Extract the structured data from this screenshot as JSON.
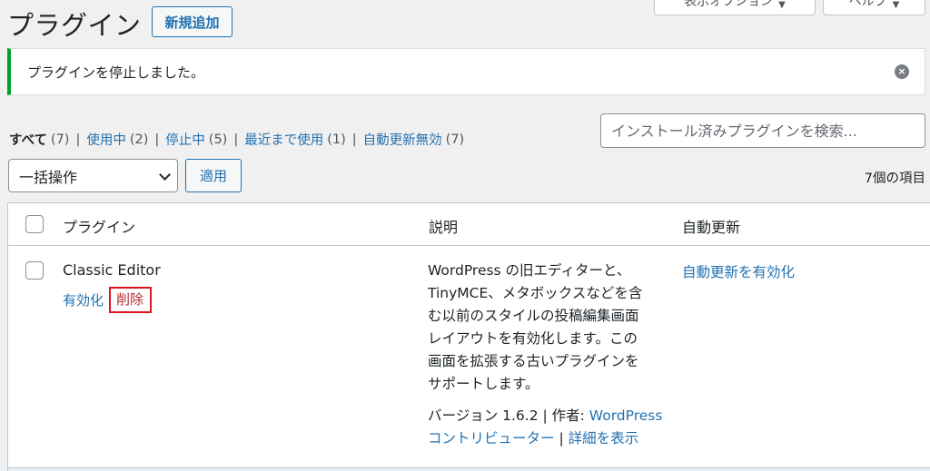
{
  "header": {
    "title": "プラグイン",
    "add_new_label": "新規追加",
    "screen_options_label": "表示オプション",
    "help_label": "ヘルプ"
  },
  "notice": {
    "message": "プラグインを停止しました。",
    "dismiss_icon": "×"
  },
  "filters": [
    {
      "label": "すべて",
      "count": "(7)",
      "current": true
    },
    {
      "label": "使用中",
      "count": "(2)"
    },
    {
      "label": "停止中",
      "count": "(5)"
    },
    {
      "label": "最近まで使用",
      "count": "(1)"
    },
    {
      "label": "自動更新無効",
      "count": "(7)"
    }
  ],
  "search": {
    "placeholder": "インストール済みプラグインを検索..."
  },
  "bulk_actions": {
    "selected": "一括操作",
    "apply_label": "適用",
    "item_count": "7個の項目"
  },
  "table": {
    "columns": {
      "plugin": "プラグイン",
      "description": "説明",
      "auto_update": "自動更新"
    },
    "rows": [
      {
        "name": "Classic Editor",
        "actions": {
          "activate": "有効化",
          "delete": "削除"
        },
        "description_lines": [
          "WordPress の旧エディターと、",
          "TinyMCE、メタボックスなどを含",
          "む以前のスタイルの投稿編集画面",
          "レイアウトを有効化します。この",
          "画面を拡張する古いプラグインを",
          "サポートします。"
        ],
        "version_text": "バージョン 1.6.2 | 作者:",
        "author_link": "WordPress",
        "author_link_line2": "コントリビューター",
        "meta_sep": "|",
        "details_link": "詳細を表示",
        "auto_update_link": "自動更新を有効化"
      }
    ]
  },
  "colors": {
    "accent": "#2271b1",
    "success": "#00a32a",
    "delete": "#b32d2e",
    "highlight_border": "#e0141e"
  }
}
